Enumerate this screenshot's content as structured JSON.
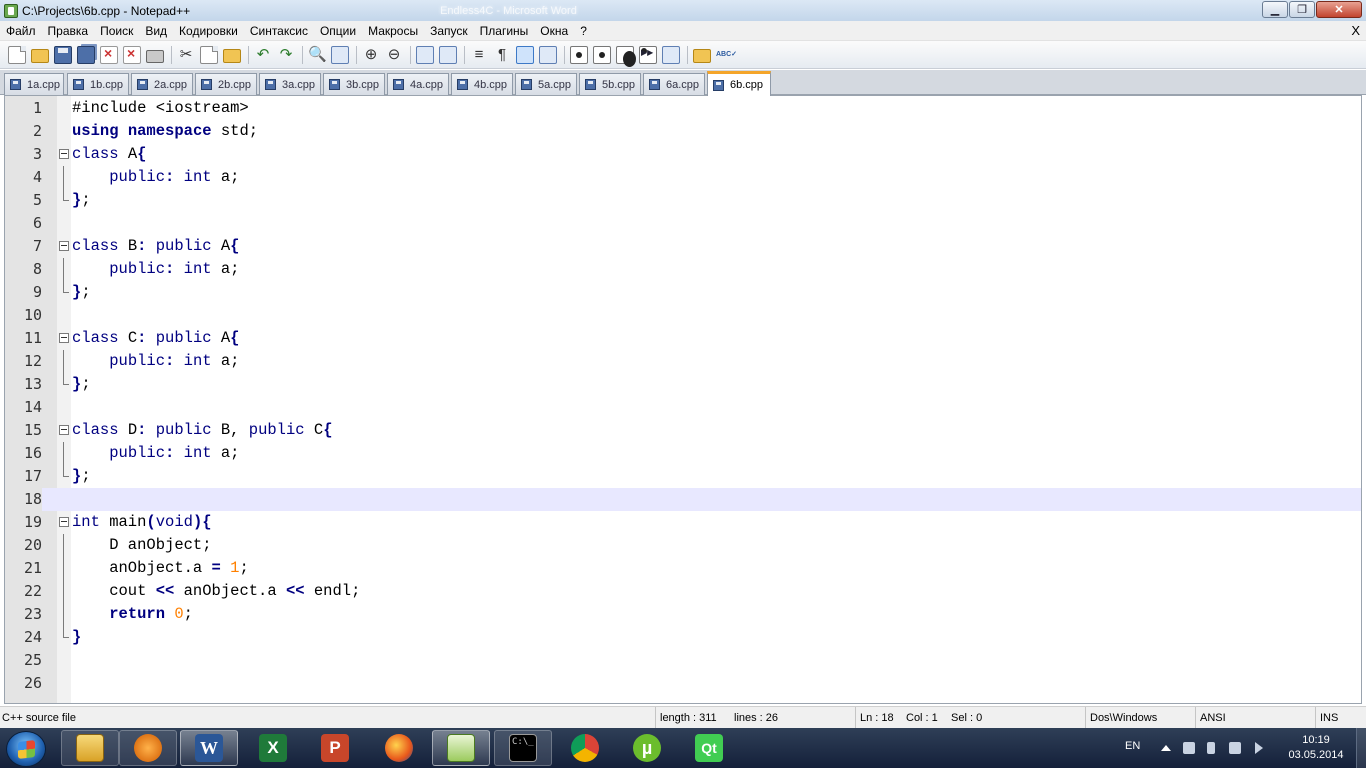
{
  "window": {
    "title": "C:\\Projects\\6b.cpp - Notepad++",
    "background_title": "Endless4C - Microsoft Word",
    "min_glyph": "▁",
    "max_glyph": "❐",
    "close_glyph": "✕"
  },
  "menu": {
    "items": [
      "Файл",
      "Правка",
      "Поиск",
      "Вид",
      "Кодировки",
      "Синтаксис",
      "Опции",
      "Макросы",
      "Запуск",
      "Плагины",
      "Окна",
      "?"
    ],
    "close_doc": "X"
  },
  "toolbar": {
    "buttons": [
      "new-file",
      "open-file",
      "save",
      "save-all",
      "close",
      "close-all",
      "print",
      "cut",
      "copy",
      "paste",
      "undo",
      "redo",
      "find",
      "replace",
      "zoom-in",
      "zoom-out",
      "sync-vertical",
      "sync-horizontal",
      "word-wrap",
      "show-all-chars",
      "indent-guide",
      "user-defined-dialog",
      "doc-map",
      "start-recording",
      "stop-recording",
      "playback",
      "run-macro-multiple",
      "save-macro",
      "launch-in-browser",
      "spell-check"
    ],
    "find_glyph": "🔍",
    "spell_glyph": "ABC✓"
  },
  "tabs": [
    {
      "label": "1a.cpp"
    },
    {
      "label": "1b.cpp"
    },
    {
      "label": "2a.cpp"
    },
    {
      "label": "2b.cpp"
    },
    {
      "label": "3a.cpp"
    },
    {
      "label": "3b.cpp"
    },
    {
      "label": "4a.cpp"
    },
    {
      "label": "4b.cpp"
    },
    {
      "label": "5a.cpp"
    },
    {
      "label": "5b.cpp"
    },
    {
      "label": "6a.cpp"
    },
    {
      "label": "6b.cpp",
      "active": true
    }
  ],
  "editor": {
    "current_line": 18,
    "line_numbers": [
      "1",
      "2",
      "3",
      "4",
      "5",
      "6",
      "7",
      "8",
      "9",
      "10",
      "11",
      "12",
      "13",
      "14",
      "15",
      "16",
      "17",
      "18",
      "19",
      "20",
      "21",
      "22",
      "23",
      "24",
      "25",
      "26"
    ]
  },
  "status": {
    "file_type": "C++ source file",
    "length": "length : 311",
    "lines": "lines : 26",
    "ln": "Ln : 18",
    "col": "Col : 1",
    "sel": "Sel : 0",
    "eol": "Dos\\Windows",
    "encoding": "ANSI",
    "mode": "INS"
  },
  "taskbar": {
    "apps": [
      "explorer",
      "media-player",
      "word",
      "excel",
      "powerpoint",
      "firefox",
      "notepad-plus-plus",
      "cmd",
      "chrome",
      "utorrent",
      "qt-creator"
    ],
    "cmd_label": "C:\\_",
    "lang": "EN",
    "time": "10:19",
    "date": "03.05.2014"
  },
  "colors": {
    "keyword": "#000080",
    "number": "#ff8000",
    "current_line": "#e8e8ff",
    "active_tab_accent": "#f4a52a"
  }
}
